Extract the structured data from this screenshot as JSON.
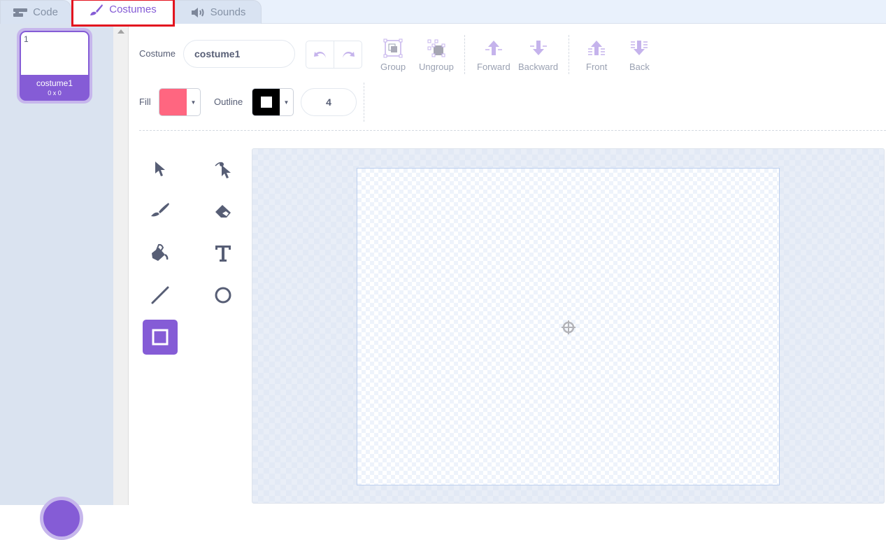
{
  "tabs": [
    {
      "label": "Code",
      "icon": "code-blocks-icon"
    },
    {
      "label": "Costumes",
      "icon": "paintbrush-icon",
      "active": true
    },
    {
      "label": "Sounds",
      "icon": "speaker-icon"
    }
  ],
  "costume_list": [
    {
      "number": "1",
      "name": "costume1",
      "size": "0 x 0",
      "selected": true
    }
  ],
  "editor": {
    "costume_label": "Costume",
    "costume_name": "costume1",
    "fill_label": "Fill",
    "fill_color": "#ff6680",
    "outline_label": "Outline",
    "outline_color": "#000000",
    "outline_width": "4",
    "toolbar": {
      "group": "Group",
      "ungroup": "Ungroup",
      "forward": "Forward",
      "backward": "Backward",
      "front": "Front",
      "back": "Back"
    },
    "tools": [
      {
        "name": "select",
        "icon": "select-arrow-icon"
      },
      {
        "name": "reshape",
        "icon": "reshape-icon"
      },
      {
        "name": "brush",
        "icon": "brush-icon"
      },
      {
        "name": "eraser",
        "icon": "eraser-icon"
      },
      {
        "name": "fill",
        "icon": "fill-bucket-icon"
      },
      {
        "name": "text",
        "icon": "text-icon"
      },
      {
        "name": "line",
        "icon": "line-icon"
      },
      {
        "name": "circle",
        "icon": "circle-icon"
      },
      {
        "name": "rectangle",
        "icon": "rectangle-icon",
        "selected": true
      }
    ]
  },
  "colors": {
    "accent": "#855cd6",
    "highlight_box": "#e3141f"
  }
}
